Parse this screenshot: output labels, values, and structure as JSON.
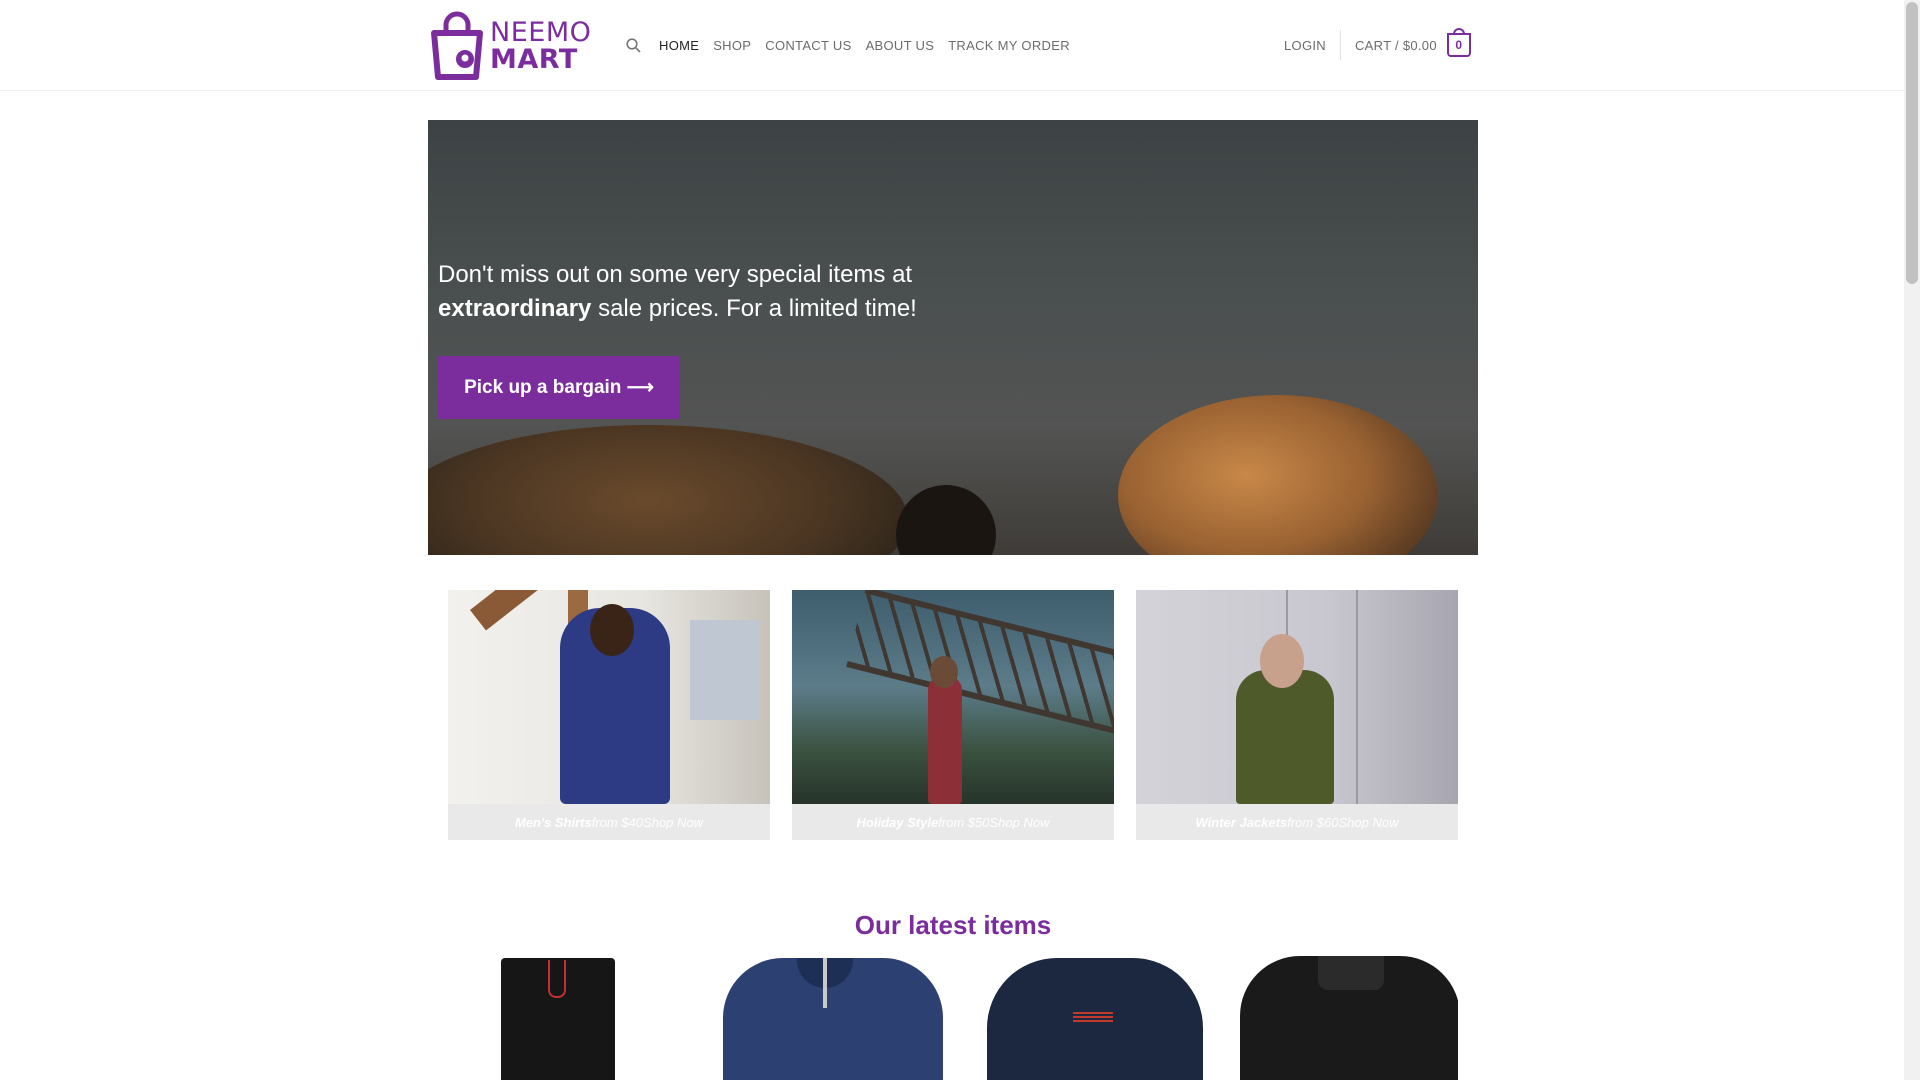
{
  "brand": {
    "logo_line1": "NEEMO",
    "logo_line2": "MART",
    "accent": "#7b2d9e"
  },
  "nav": {
    "search_icon": "search-icon",
    "items": [
      {
        "label": "HOME",
        "active": true
      },
      {
        "label": "SHOP"
      },
      {
        "label": "CONTACT US"
      },
      {
        "label": "ABOUT US"
      },
      {
        "label": "TRACK MY ORDER"
      }
    ],
    "login": "LOGIN",
    "cart_label": "CART / $0.00",
    "cart_count": "0"
  },
  "hero": {
    "text_line1": "Don't miss out on some very special items at",
    "text_bold": "extraordinary",
    "text_rest": " sale prices. For a limited time!",
    "cta": "Pick up a bargain ⟶"
  },
  "categories": [
    {
      "name": "Men's Shirts",
      "price": "from $40",
      "cta": "Shop Now"
    },
    {
      "name": "Holiday Style",
      "price": "from $50",
      "cta": "Shop Now"
    },
    {
      "name": "Winter Jackets",
      "price": "from $60",
      "cta": "Shop Now"
    }
  ],
  "latest": {
    "title": "Our latest items"
  }
}
